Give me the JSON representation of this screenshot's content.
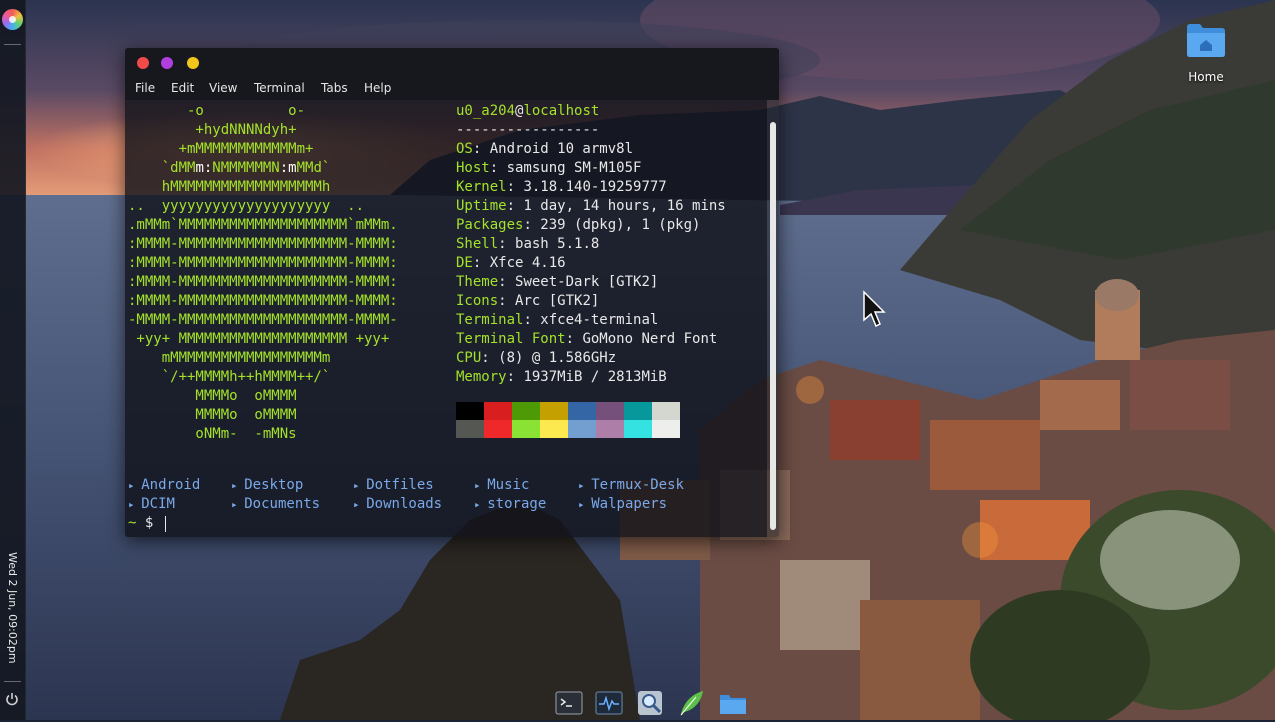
{
  "panel": {
    "clock": "Wed  2 Jun, 09:02pm",
    "items": [
      "app-menu",
      "clock",
      "power"
    ]
  },
  "desktop": {
    "icons": [
      {
        "label": "Home",
        "icon": "folder-home-icon"
      }
    ]
  },
  "terminal": {
    "window_buttons": [
      {
        "name": "close",
        "color": "#f04a4a"
      },
      {
        "name": "maximize",
        "color": "#b23ee0"
      },
      {
        "name": "minimize",
        "color": "#f2c61a"
      }
    ],
    "menu": [
      "File",
      "Edit",
      "View",
      "Terminal",
      "Tabs",
      "Help"
    ],
    "neofetch": {
      "logo": [
        "       -o          o-",
        "        +hydNNNNdyh+",
        "      +mMMMMMMMMMMMMm+",
        "    `dMM",
        "    hMMMMMMMMMMMMMMMMMMh",
        "..  yyyyyyyyyyyyyyyyyyyy  ..",
        ".mMMm`MMMMMMMMMMMMMMMMMMMM`mMMm.",
        ":MMMM-MMMMMMMMMMMMMMMMMMMM-MMMM:",
        ":MMMM-MMMMMMMMMMMMMMMMMMMM-MMMM:",
        ":MMMM-MMMMMMMMMMMMMMMMMMMM-MMMM:",
        ":MMMM-MMMMMMMMMMMMMMMMMMMM-MMMM:",
        "-MMMM-MMMMMMMMMMMMMMMMMMMM-MMMM-",
        " +yy+ MMMMMMMMMMMMMMMMMMMM +yy+",
        "    mMMMMMMMMMMMMMMMMMMm",
        "    `/++MMMMh++hMMMM++/`",
        "        MMMMo  oMMMM",
        "        MMMMo  oMMMM",
        "        oNMm-  -mMNs"
      ],
      "logo_row4": {
        "a": "    `dMM",
        "b": "m:",
        "c": "NMMMMMMN",
        "d": ":m",
        "e": "MMd`"
      },
      "user": "u0_a204",
      "at": "@",
      "host": "localhost",
      "separator": "-----------------",
      "info": [
        {
          "key": "OS",
          "value": "Android 10 armv8l"
        },
        {
          "key": "Host",
          "value": "samsung SM-M105F"
        },
        {
          "key": "Kernel",
          "value": "3.18.140-19259777"
        },
        {
          "key": "Uptime",
          "value": "1 day, 14 hours, 16 mins"
        },
        {
          "key": "Packages",
          "value": "239 (dpkg), 1 (pkg)"
        },
        {
          "key": "Shell",
          "value": "bash 5.1.8"
        },
        {
          "key": "DE",
          "value": "Xfce 4.16"
        },
        {
          "key": "Theme",
          "value": "Sweet-Dark [GTK2]"
        },
        {
          "key": "Icons",
          "value": "Arc [GTK2]"
        },
        {
          "key": "Terminal",
          "value": "xfce4-terminal"
        },
        {
          "key": "Terminal Font",
          "value": "GoMono Nerd Font"
        },
        {
          "key": "CPU",
          "value": "(8) @ 1.586GHz"
        },
        {
          "key": "Memory",
          "value": "1937MiB / 2813MiB"
        }
      ],
      "palette_dark": [
        "#000000",
        "#d81e1e",
        "#4e9a06",
        "#c4a000",
        "#3465a4",
        "#75507b",
        "#06989a",
        "#d3d7cf"
      ],
      "palette_bright": [
        "#555753",
        "#ef2929",
        "#8ae234",
        "#fce94f",
        "#729fcf",
        "#ad7fa8",
        "#34e2e2",
        "#eeeeec"
      ]
    },
    "ls": {
      "row1": [
        "Android",
        "Desktop",
        "Dotfiles",
        "Music",
        "Termux-Desk"
      ],
      "row2": [
        "DCIM",
        "Documents",
        "Downloads",
        "storage",
        "Walpapers"
      ]
    },
    "prompt": {
      "tilde": "~",
      "dollar": "$"
    }
  },
  "dock": {
    "items": [
      {
        "name": "terminal-emulator",
        "icon": "terminal-icon"
      },
      {
        "name": "task-manager",
        "icon": "activity-monitor-icon"
      },
      {
        "name": "app-finder",
        "icon": "search-icon"
      },
      {
        "name": "text-editor",
        "icon": "feather-icon"
      },
      {
        "name": "file-manager",
        "icon": "folder-icon"
      }
    ]
  }
}
